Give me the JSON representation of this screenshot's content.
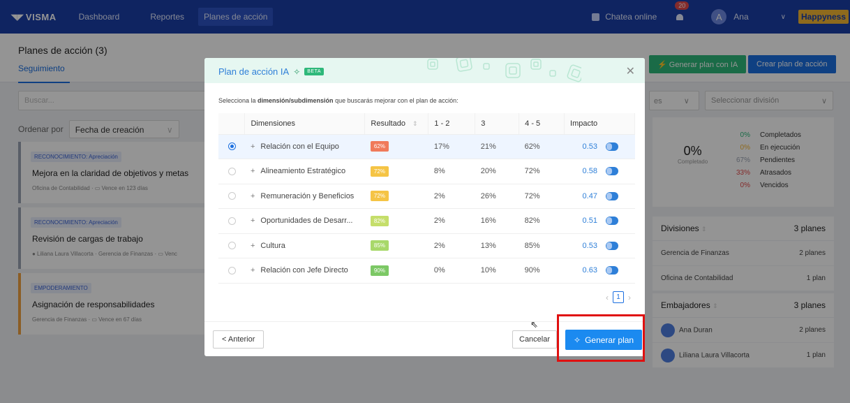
{
  "nav": {
    "logo": "VISMA",
    "items": [
      "Dashboard",
      "Reportes",
      "Planes de acción"
    ],
    "chat_label": "Chatea online",
    "notif_count": "20",
    "avatar_letter": "A",
    "user_name": "Ana",
    "brand": "Happyness"
  },
  "page": {
    "title": "Planes de acción (3)",
    "tab": "Seguimiento",
    "btn_ia": "Generar plan con IA",
    "btn_create": "Crear plan de acción",
    "search_placeholder": "Buscar...",
    "filter1": "es",
    "filter2": "Seleccionar división",
    "sort_label": "Ordenar por",
    "sort_value": "Fecha de creación"
  },
  "cards": [
    {
      "tag": "RECONOCIMIENTO: Apreciación",
      "title": "Mejora en la claridad de objetivos y metas",
      "meta": "Oficina de Contabilidad  ·  ▭ Vence en 123 días"
    },
    {
      "tag": "RECONOCIMIENTO: Apreciación",
      "title": "Revisión de cargas de trabajo",
      "meta": "● Liliana Laura Villacorta  ·  Gerencia de Finanzas  ·  ▭ Venc"
    },
    {
      "tag": "EMPODERAMIENTO",
      "title": "Asignación de responsabilidades",
      "meta": "Gerencia de Finanzas  ·  ▭ Vence en 67 días"
    }
  ],
  "stats": {
    "big": "0%",
    "big_label": "Completado",
    "rows": [
      {
        "pct": "0%",
        "label": "Completados",
        "color": "#2eb87a"
      },
      {
        "pct": "0%",
        "label": "En ejecución",
        "color": "#f5b733"
      },
      {
        "pct": "67%",
        "label": "Pendientes",
        "color": "#9aa3b2"
      },
      {
        "pct": "33%",
        "label": "Atrasados",
        "color": "#e34a4a"
      },
      {
        "pct": "0%",
        "label": "Vencidos",
        "color": "#e34a4a"
      }
    ]
  },
  "divisiones": {
    "title": "Divisiones",
    "count": "3 planes",
    "rows": [
      {
        "name": "Gerencia de Finanzas",
        "value": "2 planes"
      },
      {
        "name": "Oficina de Contabilidad",
        "value": "1 plan"
      }
    ]
  },
  "embajadores": {
    "title": "Embajadores",
    "count": "3 planes",
    "rows": [
      {
        "name": "Ana Duran",
        "value": "2 planes"
      },
      {
        "name": "Liliana Laura Villacorta",
        "value": "1 plan"
      }
    ]
  },
  "modal": {
    "title": "Plan de acción IA",
    "beta": "BETA",
    "instruction_pre": "Selecciona la ",
    "instruction_bold": "dimensión/subdimensión",
    "instruction_post": " que buscarás mejorar con el plan de acción:",
    "headers": [
      "Dimensiones",
      "Resultado",
      "1 - 2",
      "3",
      "4 - 5",
      "Impacto"
    ],
    "rows": [
      {
        "name": "Relación con el Equipo",
        "result": "62%",
        "color": "#f07a5a",
        "c12": "17%",
        "c3": "21%",
        "c45": "62%",
        "impact": "0.53",
        "selected": true
      },
      {
        "name": "Alineamiento Estratégico",
        "result": "72%",
        "color": "#f5c445",
        "c12": "8%",
        "c3": "20%",
        "c45": "72%",
        "impact": "0.58",
        "selected": false
      },
      {
        "name": "Remuneración y Beneficios",
        "result": "72%",
        "color": "#f5c445",
        "c12": "2%",
        "c3": "26%",
        "c45": "72%",
        "impact": "0.47",
        "selected": false
      },
      {
        "name": "Oportunidades de Desarr...",
        "result": "82%",
        "color": "#c5de6a",
        "c12": "2%",
        "c3": "16%",
        "c45": "82%",
        "impact": "0.51",
        "selected": false
      },
      {
        "name": "Cultura",
        "result": "85%",
        "color": "#a8d86a",
        "c12": "2%",
        "c3": "13%",
        "c45": "85%",
        "impact": "0.53",
        "selected": false
      },
      {
        "name": "Relación con Jefe Directo",
        "result": "90%",
        "color": "#7cc865",
        "c12": "0%",
        "c3": "10%",
        "c45": "90%",
        "impact": "0.63",
        "selected": false
      }
    ],
    "page": "1",
    "btn_prev": "< Anterior",
    "btn_cancel": "Cancelar",
    "btn_generate": "Generar plan"
  }
}
